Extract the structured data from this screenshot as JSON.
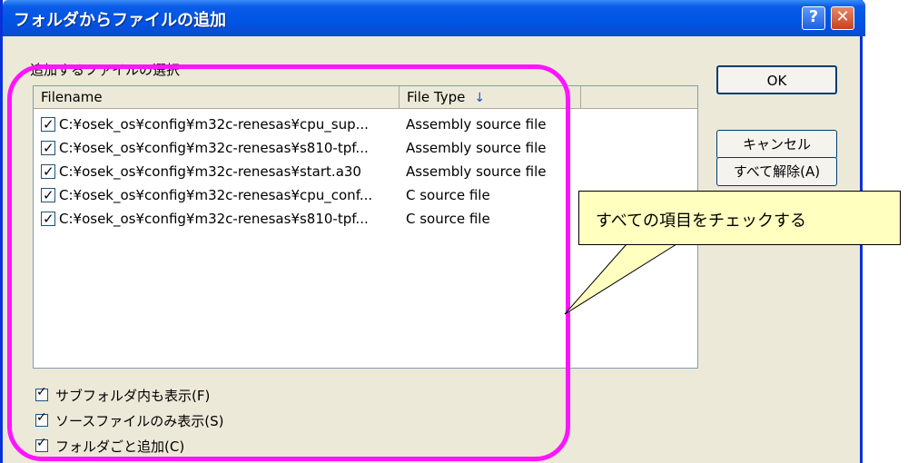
{
  "window": {
    "title": "フォルダからファイルの追加"
  },
  "titlebar": {
    "help_label": "?",
    "close_label": "✕"
  },
  "list": {
    "section_label": "追加するファイルの選択",
    "columns": [
      "Filename",
      "File Type"
    ],
    "sort_indicator": "↓",
    "rows": [
      {
        "checked": true,
        "filename": "C:¥osek_os¥config¥m32c-renesas¥cpu_sup...",
        "type": "Assembly source file"
      },
      {
        "checked": true,
        "filename": "C:¥osek_os¥config¥m32c-renesas¥s810-tpf...",
        "type": "Assembly source file"
      },
      {
        "checked": true,
        "filename": "C:¥osek_os¥config¥m32c-renesas¥start.a30",
        "type": "Assembly source file"
      },
      {
        "checked": true,
        "filename": "C:¥osek_os¥config¥m32c-renesas¥cpu_conf...",
        "type": "C source file"
      },
      {
        "checked": true,
        "filename": "C:¥osek_os¥config¥m32c-renesas¥s810-tpf...",
        "type": "C source file"
      }
    ]
  },
  "options": [
    {
      "checked": true,
      "label": "サブフォルダ内も表示(F)"
    },
    {
      "checked": true,
      "label": "ソースファイルのみ表示(S)"
    },
    {
      "checked": true,
      "label": "フォルダごと追加(C)"
    }
  ],
  "buttons": {
    "ok": "OK",
    "cancel": "キャンセル",
    "unselect_all": "すべて解除(A)"
  },
  "annotation": {
    "text": "すべての項目をチェックする",
    "highlight_color": "#ff14ff",
    "callout_bg": "#ffffc0"
  }
}
